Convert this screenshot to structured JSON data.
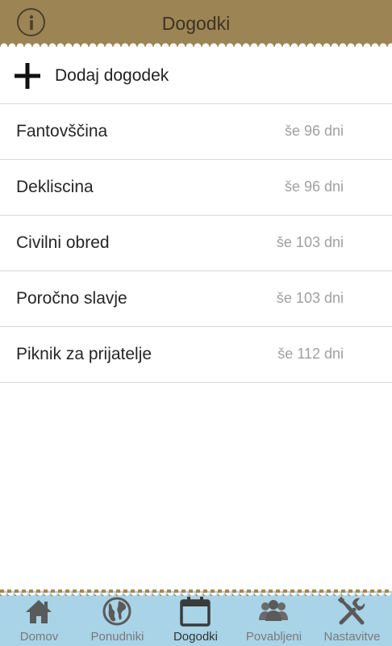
{
  "header": {
    "title": "Dogodki",
    "info_icon": "info-icon",
    "background": "#9c8455"
  },
  "add_event": {
    "label": "Dodaj dogodek",
    "icon": "plus-icon"
  },
  "events": [
    {
      "name": "Fantovščina",
      "remaining": "še 96 dni"
    },
    {
      "name": "Dekliscina",
      "remaining": "še 96 dni"
    },
    {
      "name": "Civilni obred",
      "remaining": "še 103 dni"
    },
    {
      "name": "Poročno slavje",
      "remaining": "še 103 dni"
    },
    {
      "name": "Piknik za prijatelje",
      "remaining": "še 112 dni"
    }
  ],
  "bottom_nav": {
    "background": "#a9d3e6",
    "items": [
      {
        "label": "Domov",
        "icon": "home-icon",
        "active": false
      },
      {
        "label": "Ponudniki",
        "icon": "globe-icon",
        "active": false
      },
      {
        "label": "Dogodki",
        "icon": "calendar-icon",
        "active": true
      },
      {
        "label": "Povabljeni",
        "icon": "people-icon",
        "active": false
      },
      {
        "label": "Nastavitve",
        "icon": "tools-icon",
        "active": false
      }
    ]
  }
}
